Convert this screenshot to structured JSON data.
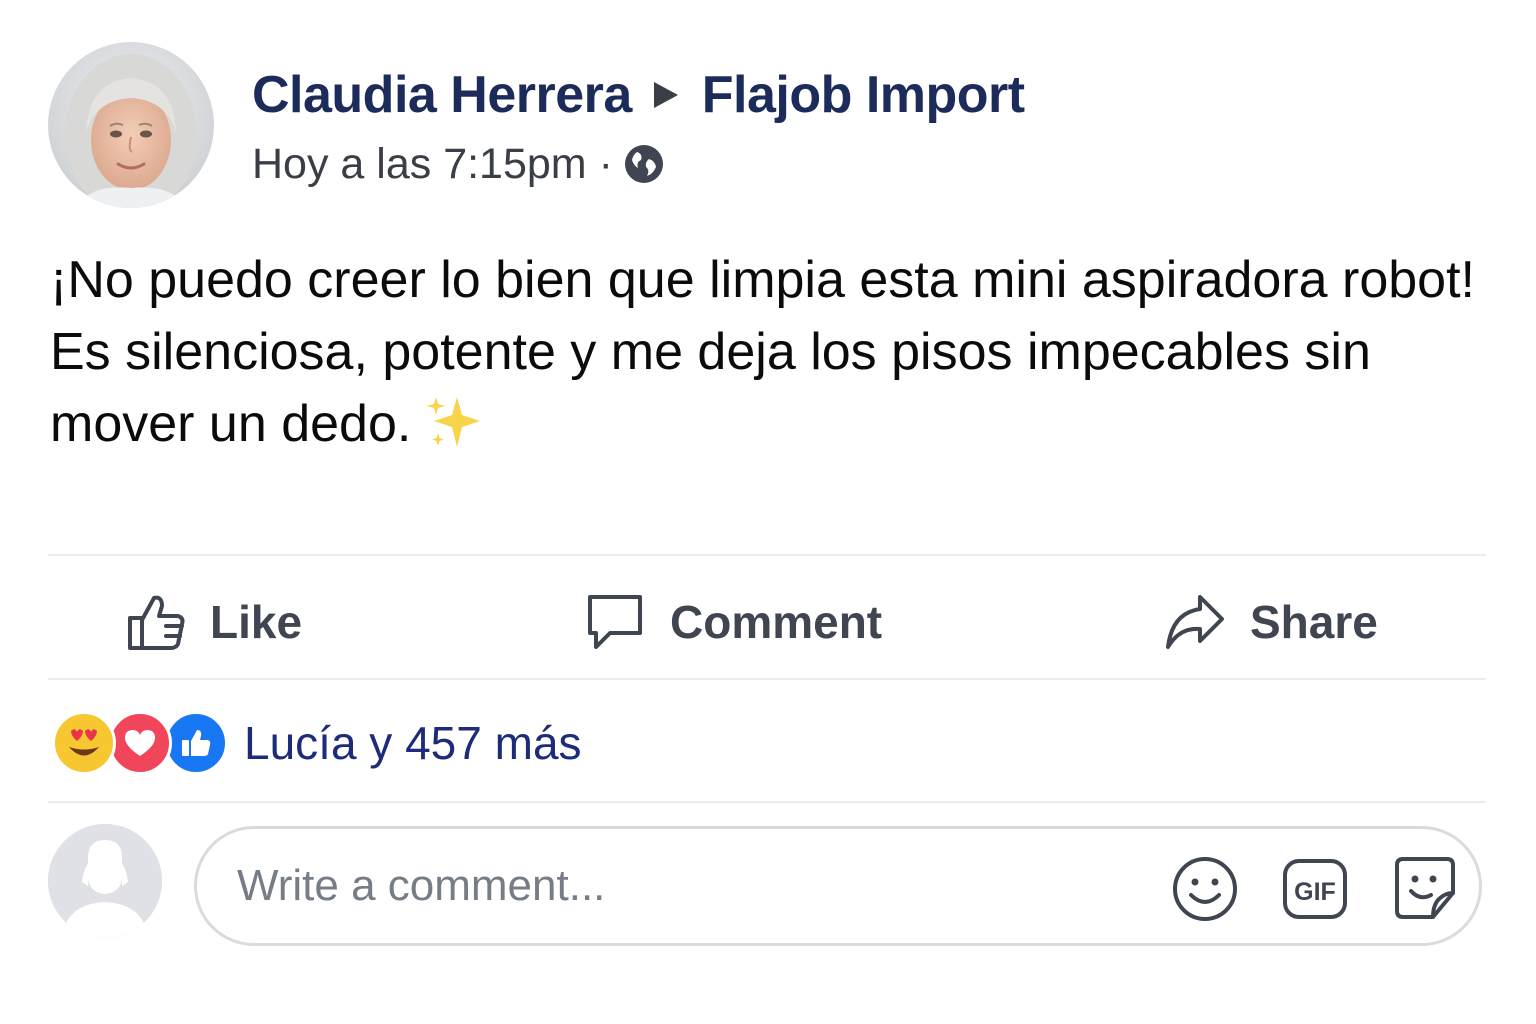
{
  "post": {
    "author": "Claudia Herrera",
    "target": "Flajob Import",
    "timestamp": "Hoy a las 7:15pm",
    "separator": "·",
    "privacy_icon": "globe-icon",
    "text_line1": "¡No puedo creer lo bien que limpia esta mini aspiradora robot!",
    "text_line2": "Es silenciosa, potente y me deja los pisos impecables sin mover un dedo.",
    "text_emoji": "sparkles"
  },
  "actions": {
    "like_label": "Like",
    "comment_label": "Comment",
    "share_label": "Share"
  },
  "reactions": {
    "icons": [
      "heart-eyes-emoji",
      "love-reaction",
      "like-reaction"
    ],
    "summary": "Lucía y 457 más"
  },
  "composer": {
    "placeholder": "Write a comment...",
    "value": "",
    "icons": [
      "emoji-icon",
      "gif-icon",
      "sticker-icon"
    ]
  },
  "colors": {
    "name_blue": "#1c2b5a",
    "link_blue": "#1c2b7a",
    "like_blue": "#1877f2",
    "love_red": "#f0455a",
    "emoji_yellow": "#f7c731",
    "text_dark": "#0b0b0b",
    "muted": "#3f4651",
    "divider": "#ebecef"
  }
}
